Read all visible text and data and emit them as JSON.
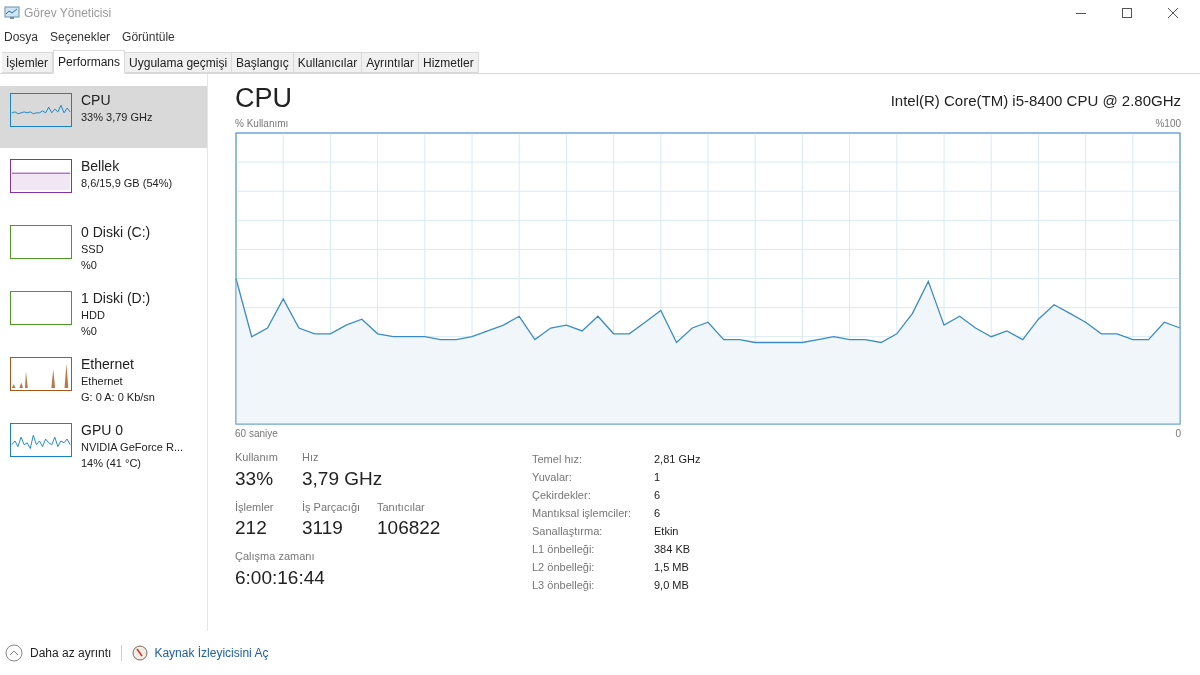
{
  "window": {
    "title": "Görev Yöneticisi"
  },
  "menu": [
    "Dosya",
    "Seçenekler",
    "Görüntüle"
  ],
  "tabs": [
    {
      "label": "İşlemler",
      "selected": false
    },
    {
      "label": "Performans",
      "selected": true
    },
    {
      "label": "Uygulama geçmişi",
      "selected": false
    },
    {
      "label": "Başlangıç",
      "selected": false
    },
    {
      "label": "Kullanıcılar",
      "selected": false
    },
    {
      "label": "Ayrıntılar",
      "selected": false
    },
    {
      "label": "Hizmetler",
      "selected": false
    }
  ],
  "sidebar": {
    "items": [
      {
        "kind": "cpu",
        "name": "CPU",
        "lines": [
          "33% 3,79 GHz"
        ],
        "color": "#1883c6",
        "selected": true
      },
      {
        "kind": "memory",
        "name": "Bellek",
        "lines": [
          "8,6/15,9 GB (54%)"
        ],
        "color": "#8b2fa8",
        "selected": false
      },
      {
        "kind": "disk",
        "name": "0 Diski (C:)",
        "lines": [
          "SSD",
          "%0"
        ],
        "color": "#4d9a23",
        "selected": false
      },
      {
        "kind": "disk",
        "name": "1 Diski (D:)",
        "lines": [
          "HDD",
          "%0"
        ],
        "color": "#4d9a23",
        "selected": false
      },
      {
        "kind": "network",
        "name": "Ethernet",
        "lines": [
          "Ethernet",
          "G: 0 A: 0 Kb/sn"
        ],
        "color": "#a8561a",
        "selected": false
      },
      {
        "kind": "gpu",
        "name": "GPU 0",
        "lines": [
          "NVIDIA GeForce R...",
          "14% (41 °C)"
        ],
        "color": "#1883c6",
        "selected": false
      }
    ]
  },
  "main": {
    "title": "CPU",
    "model": "Intel(R) Core(TM) i5-8400 CPU @ 2.80GHz",
    "chart": {
      "ylabel": "% Kullanımı",
      "ymax": "%100",
      "xstart": "60 saniye",
      "xend": "0"
    },
    "stats": [
      {
        "label": "Kullanım",
        "value": "33%"
      },
      {
        "label": "Hız",
        "value": "3,79 GHz"
      },
      {
        "label": "İşlemler",
        "value": "212"
      },
      {
        "label": "İş Parçacığı",
        "value": "3119"
      },
      {
        "label": "Tanıtıcılar",
        "value": "106822"
      },
      {
        "label": "Çalışma zamanı",
        "value": "6:00:16:44"
      }
    ],
    "details": [
      {
        "label": "Temel hız:",
        "value": "2,81 GHz"
      },
      {
        "label": "Yuvalar:",
        "value": "1"
      },
      {
        "label": "Çekirdekler:",
        "value": "6"
      },
      {
        "label": "Mantıksal işlemciler:",
        "value": "6"
      },
      {
        "label": "Sanallaştırma:",
        "value": "Etkin"
      },
      {
        "label": "L1 önbelleği:",
        "value": "384 KB"
      },
      {
        "label": "L2 önbelleği:",
        "value": "1,5 MB"
      },
      {
        "label": "L3 önbelleği:",
        "value": "9,0 MB"
      }
    ]
  },
  "footer": {
    "less_details": "Daha az ayrıntı",
    "resource_monitor": "Kaynak İzleyicisini Aç"
  }
}
